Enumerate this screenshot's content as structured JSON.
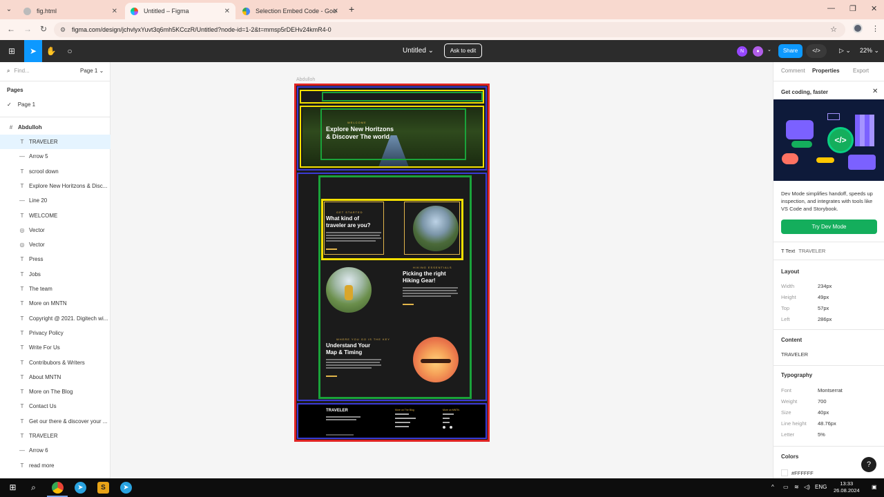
{
  "browser": {
    "tabs": [
      {
        "title": "fig.html",
        "active": false
      },
      {
        "title": "Untitled – Figma",
        "active": true
      },
      {
        "title": "Selection Embed Code - Googl",
        "active": false
      }
    ],
    "url": "figma.com/design/jchvlyxYuvt3q6mh5KCczR/Untitled?node-id=1-2&t=mmsp5rDEHv24kmR4-0"
  },
  "figma": {
    "file_title": "Untitled",
    "ask_to_edit": "Ask to edit",
    "avatar_initial": "N",
    "share": "Share",
    "zoom": "22%"
  },
  "left_panel": {
    "find_placeholder": "Find...",
    "page_selector": "Page 1",
    "pages_heading": "Pages",
    "current_page": "Page 1",
    "frame_name": "Abdulloh",
    "layers": [
      {
        "type": "text",
        "name": "TRAVELER",
        "selected": true
      },
      {
        "type": "line",
        "name": "Arrow 5"
      },
      {
        "type": "text",
        "name": "scrool down"
      },
      {
        "type": "text",
        "name": "Explore New Horitzons & Disc..."
      },
      {
        "type": "line",
        "name": "Line 20"
      },
      {
        "type": "text",
        "name": "WELCOME"
      },
      {
        "type": "vector",
        "name": "Vector"
      },
      {
        "type": "vector",
        "name": "Vector"
      },
      {
        "type": "text",
        "name": "Press"
      },
      {
        "type": "text",
        "name": "Jobs"
      },
      {
        "type": "text",
        "name": "The team"
      },
      {
        "type": "text",
        "name": "More on MNTN"
      },
      {
        "type": "text",
        "name": "Copyright @ 2021. Digitech wi..."
      },
      {
        "type": "text",
        "name": "Privacy Policy"
      },
      {
        "type": "text",
        "name": "Write For Us"
      },
      {
        "type": "text",
        "name": "Contribubors & Writers"
      },
      {
        "type": "text",
        "name": "About MNTN"
      },
      {
        "type": "text",
        "name": "More on The Blog"
      },
      {
        "type": "text",
        "name": "Contact Us"
      },
      {
        "type": "text",
        "name": "Get our there & discover your ..."
      },
      {
        "type": "text",
        "name": "TRAVELER"
      },
      {
        "type": "line",
        "name": "Arrow 6"
      },
      {
        "type": "text",
        "name": "read more"
      }
    ]
  },
  "canvas": {
    "frame_label": "Abdulloh",
    "hero": {
      "welcome": "WELCOME",
      "headline_1": "Explore New Horitzons",
      "headline_2": "& Discover The world"
    },
    "section1": {
      "eyebrow": "GET STARTED",
      "title_1": "What kind of",
      "title_2": "traveler are you?"
    },
    "section2": {
      "eyebrow": "HIKING ESSENTIALS",
      "title_1": "Picking the right",
      "title_2": "Hiking Gear!"
    },
    "section3": {
      "eyebrow": "WHERE YOU GO IS THE KEY",
      "title_1": "Understand Your",
      "title_2": "Map & Timing"
    },
    "footer": {
      "brand": "TRAVELER",
      "col1": "More on The Blog",
      "col2": "More on MNTN"
    }
  },
  "right_panel": {
    "tabs": [
      "Comment",
      "Properties",
      "Export"
    ],
    "active_tab": "Properties",
    "promo_title": "Get coding, faster",
    "promo_text": "Dev Mode simplifies handoff, speeds up inspection, and integrates with tools like VS Code and Storybook.",
    "try_button": "Try Dev Mode",
    "selection_type": "Text",
    "selection_name": "TRAVELER",
    "layout_heading": "Layout",
    "layout": [
      {
        "label": "Width",
        "value": "234px"
      },
      {
        "label": "Height",
        "value": "49px"
      },
      {
        "label": "Top",
        "value": "57px"
      },
      {
        "label": "Left",
        "value": "286px"
      }
    ],
    "content_heading": "Content",
    "content_value": "TRAVELER",
    "typography_heading": "Typography",
    "typography": [
      {
        "label": "Font",
        "value": "Montserrat"
      },
      {
        "label": "Weight",
        "value": "700"
      },
      {
        "label": "Size",
        "value": "40px"
      },
      {
        "label": "Line height",
        "value": "48.76px"
      },
      {
        "label": "Letter",
        "value": "5%"
      }
    ],
    "colors_heading": "Colors",
    "color_hex": "#FFFFFF"
  },
  "taskbar": {
    "lang": "ENG",
    "time": "13:33",
    "date": "26.08.2024"
  },
  "colors": {
    "figma_blue": "#0d99ff",
    "dev_green": "#14ae5c",
    "outline_red": "#e02424",
    "outline_blue": "#3b3bd6",
    "outline_yellow": "#f5e000",
    "outline_green": "#1aa33a"
  }
}
